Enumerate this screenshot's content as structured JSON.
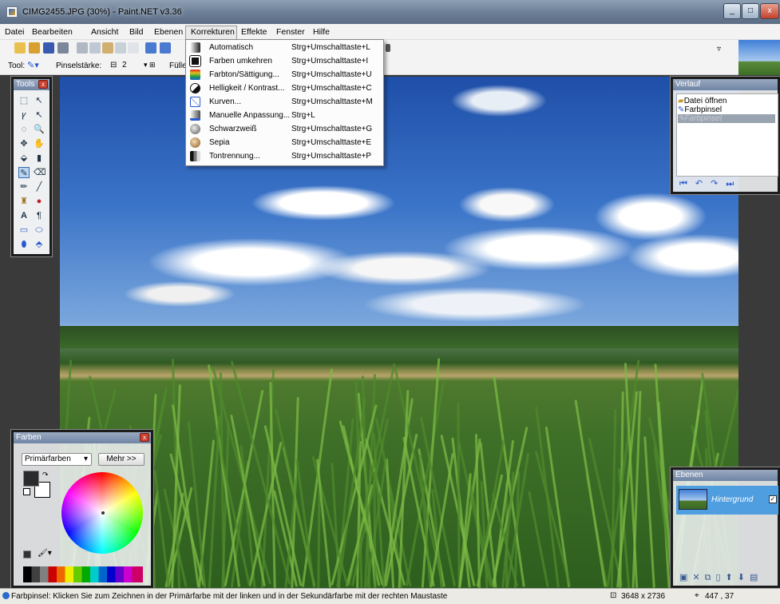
{
  "window": {
    "title": "CIMG2455.JPG (30%) - Paint.NET v3.36",
    "controls": [
      "_",
      "□",
      "x"
    ]
  },
  "menu": {
    "items": [
      "Datei",
      "Bearbeiten",
      "Ansicht",
      "Bild",
      "Ebenen",
      "Korrekturen",
      "Effekte",
      "Fenster",
      "Hilfe"
    ],
    "active": "Korrekturen"
  },
  "toolbar": {
    "tool_label": "Tool:",
    "brush_label": "Pinselstärke:",
    "brush_value": "2",
    "fill_label": "Fülle"
  },
  "dropdown": {
    "items": [
      {
        "label": "Automatisch",
        "shortcut": "Strg+Umschalttaste+L",
        "icon": "levels-icon"
      },
      {
        "label": "Farben umkehren",
        "shortcut": "Strg+Umschalttaste+I",
        "icon": "invert-colors-icon"
      },
      {
        "label": "Farbton/Sättigung...",
        "shortcut": "Strg+Umschalttaste+U",
        "icon": "hue-saturation-icon"
      },
      {
        "label": "Helligkeit / Kontrast...",
        "shortcut": "Strg+Umschalttaste+C",
        "icon": "brightness-contrast-icon"
      },
      {
        "label": "Kurven...",
        "shortcut": "Strg+Umschalttaste+M",
        "icon": "curves-icon"
      },
      {
        "label": "Manuelle Anpassung...",
        "shortcut": "Strg+L",
        "icon": "levels-adjust-icon"
      },
      {
        "label": "Schwarzweiß",
        "shortcut": "Strg+Umschalttaste+G",
        "icon": "black-white-icon"
      },
      {
        "label": "Sepia",
        "shortcut": "Strg+Umschalttaste+E",
        "icon": "sepia-icon"
      },
      {
        "label": "Tontrennung...",
        "shortcut": "Strg+Umschalttaste+P",
        "icon": "posterize-icon"
      }
    ]
  },
  "tools_panel": {
    "title": "Tools",
    "glyphs": [
      "⬚",
      "↖",
      "ꝩ",
      "↖",
      "◌",
      "🔍",
      "✥",
      "✋",
      "⬙",
      "▮",
      "✎",
      "⌫",
      "✏",
      "╱",
      "♜",
      "●",
      "A",
      "¶",
      "▭",
      "⬭",
      "⬮",
      "⬘"
    ]
  },
  "colors_panel": {
    "title": "Farben",
    "select_value": "Primärfarben",
    "more_button": "Mehr >>",
    "primary_color": "#2b2b2b",
    "secondary_color": "#ffffff"
  },
  "history_panel": {
    "title": "Verlauf",
    "items": [
      "Datei öffnen",
      "Farbpinsel",
      "Farbpinsel"
    ],
    "selected_index": 2
  },
  "layers_panel": {
    "title": "Ebenen",
    "layer_name": "Hintergrund",
    "visible": "✓"
  },
  "status": {
    "text": "Farbpinsel: Klicken Sie zum Zeichnen in der Primärfarbe mit der linken und in der Sekundärfarbe mit der rechten Maustaste",
    "image_size": "3648 x 2736",
    "cursor_pos": "447 , 37"
  }
}
